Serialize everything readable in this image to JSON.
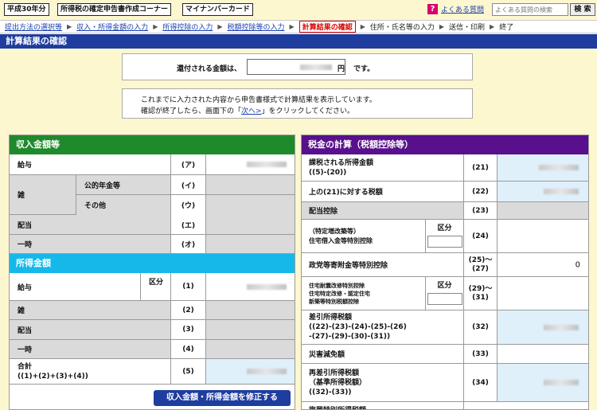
{
  "header": {
    "era_button": "平成30年分",
    "corner_button": "所得税の確定申告書作成コーナー",
    "mynumber_button": "マイナンバーカード",
    "help_icon": "?",
    "help_link": "よくある質問",
    "search_placeholder": "よくある質問の検索",
    "search_button": "検 索"
  },
  "breadcrumb": [
    {
      "label": "提出方法の選択等"
    },
    {
      "label": "収入・所得金額の入力"
    },
    {
      "label": "所得控除の入力"
    },
    {
      "label": "税額控除等の入力"
    },
    {
      "label": "計算結果の確認"
    },
    {
      "label": "住所・氏名等の入力"
    },
    {
      "label": "送信・印刷"
    },
    {
      "label": "終了"
    }
  ],
  "page_title": "計算結果の確認",
  "refund": {
    "label": "還付される金額は、",
    "unit": "円",
    "tail": "です。"
  },
  "note": {
    "line1": "これまでに入力された内容から申告書様式で計算結果を表示しています。",
    "line2_pre": "確認が終了したら、画面下の「",
    "line2_link": "次へ>",
    "line2_post": "」をクリックしてください。"
  },
  "income": {
    "title": "収入金額等",
    "salary": "給与",
    "salary_code": "(ア)",
    "misc": "雑",
    "pension": "公的年金等",
    "pension_code": "(イ)",
    "other": "その他",
    "other_code": "(ウ)",
    "dividend": "配当",
    "dividend_code": "(エ)",
    "temporary": "一時",
    "temporary_code": "(オ)"
  },
  "earnings": {
    "title": "所得金額",
    "salary": "給与",
    "kubun": "区分",
    "salary_code": "(1)",
    "misc": "雑",
    "misc_code": "(2)",
    "dividend": "配当",
    "dividend_code": "(3)",
    "temporary": "一時",
    "temporary_code": "(4)",
    "total_line1": "合計",
    "total_line2": "((1)+(2)+(3)+(4))",
    "total_code": "(5)"
  },
  "fix_button": "収入金額・所得金額を修正する",
  "tax": {
    "title": "税金の計算（税額控除等）",
    "r21_line1": "課税される所得金額",
    "r21_line2": "((5)-(20))",
    "r21_code": "(21)",
    "r22": "上の(21)に対する税額",
    "r22_code": "(22)",
    "r23": "配当控除",
    "r23_code": "(23)",
    "r24_line1": "（特定増改築等）",
    "r24_line2": "住宅借入金等特別控除",
    "r24_kubun": "区分",
    "r24_code": "(24)",
    "r25": "政党等寄附金等特別控除",
    "r25_code1": "(25)〜",
    "r25_code2": "(27)",
    "r25_value": "0",
    "r29_line1": "住宅耐震改修特別控除",
    "r29_line2": "住宅特定改修・認定住宅",
    "r29_line3": "新築等特別税額控除",
    "r29_kubun": "区分",
    "r29_code1": "(29)〜",
    "r29_code2": "(31)",
    "r32_line1": "差引所得税額",
    "r32_line2": "((22)-(23)-(24)-(25)-(26)",
    "r32_line3": "-(27)-(29)-(30)-(31))",
    "r32_code": "(32)",
    "r33": "災害減免額",
    "r33_code": "(33)",
    "r34_line1": "再差引所得税額",
    "r34_line2": "（基準所得税額）",
    "r34_line3": "((32)-(33))",
    "r34_code": "(34)",
    "r35_partial": "復興特別所得税額"
  }
}
